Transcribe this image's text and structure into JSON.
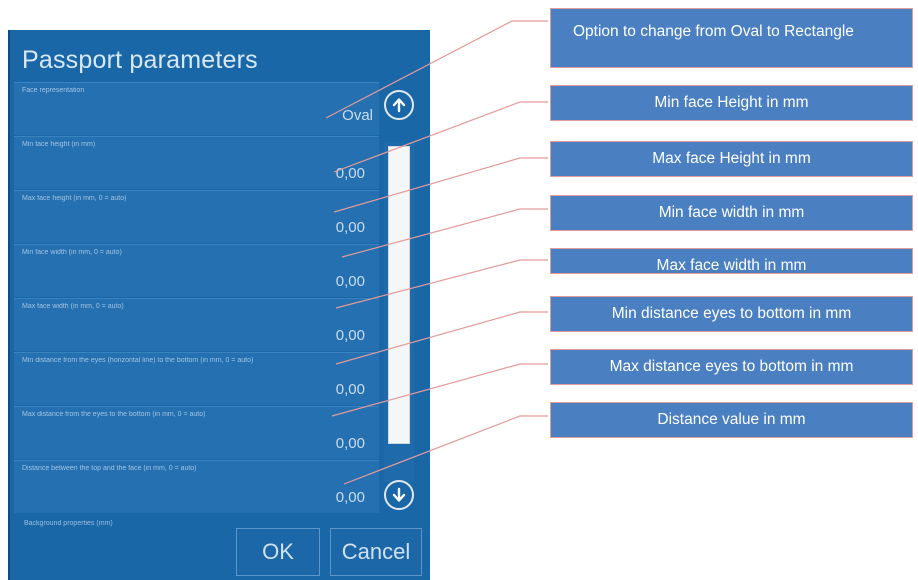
{
  "dialog": {
    "title": "Passport parameters",
    "rows": [
      {
        "label": "Face representation",
        "value": "Oval"
      },
      {
        "label": "Min face height (in mm)",
        "value": "0,00"
      },
      {
        "label": "Max face height (in mm, 0 = auto)",
        "value": "0,00"
      },
      {
        "label": "Min face width (in mm, 0 = auto)",
        "value": "0,00"
      },
      {
        "label": "Max face width (in mm, 0 = auto)",
        "value": "0,00"
      },
      {
        "label": "Min distance from the eyes (horizontal line) to the bottom (in mm, 0 = auto)",
        "value": "0,00"
      },
      {
        "label": "Max distance from the eyes to the bottom (in mm, 0 = auto)",
        "value": "0,00"
      },
      {
        "label": "Distance between the top and the face (in mm, 0 = auto)",
        "value": "0,00"
      }
    ],
    "footer_label": "Background properties (mm)",
    "ok_label": "OK",
    "cancel_label": "Cancel"
  },
  "callouts": [
    "Option to change from Oval to Rectangle",
    "Min face Height in mm",
    "Max face Height in mm",
    "Min face width in mm",
    "Max face width in mm",
    "Min distance eyes to bottom in mm",
    "Max distance eyes to bottom in mm",
    "Distance value in mm"
  ],
  "colors": {
    "dialog_bg": "#1a67a8",
    "callout_bg": "#4a7fc1",
    "leader_line": "#e39a9a"
  }
}
